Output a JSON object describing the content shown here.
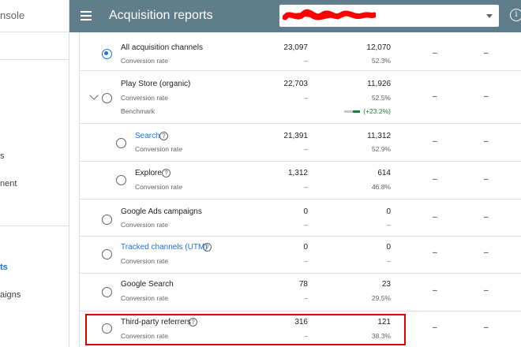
{
  "sidebar": {
    "brand": "nsole",
    "items": [
      "s",
      "nent",
      "ts",
      "aigns"
    ]
  },
  "header": {
    "title": "Acquisition reports",
    "app_selector_value": "",
    "info_glyph": "i"
  },
  "labels": {
    "conversion_rate": "Conversion rate",
    "benchmark": "Benchmark",
    "dash": "–"
  },
  "rows": [
    {
      "name": "All acquisition channels",
      "visitors": "23,097",
      "installers": "12,070",
      "rate": "52.3%",
      "conv_dash": "–",
      "selected": true
    },
    {
      "name": "Play Store (organic)",
      "visitors": "22,703",
      "installers": "11,926",
      "rate": "52.5%",
      "conv_dash": "–",
      "benchmark_change": "(+23.2%)",
      "expandable": true
    },
    {
      "name": "Search",
      "visitors": "21,391",
      "installers": "11,312",
      "rate": "52.9%",
      "conv_dash": "–",
      "link": true,
      "help": true
    },
    {
      "name": "Explore",
      "visitors": "1,312",
      "installers": "614",
      "rate": "46.8%",
      "conv_dash": "–",
      "help": true
    },
    {
      "name": "Google Ads campaigns",
      "visitors": "0",
      "installers": "0",
      "rate": "–",
      "conv_dash": "–"
    },
    {
      "name": "Tracked channels (UTM)",
      "visitors": "0",
      "installers": "0",
      "rate": "–",
      "conv_dash": "–",
      "link": true,
      "help": true
    },
    {
      "name": "Google Search",
      "visitors": "78",
      "installers": "23",
      "rate": "29.5%",
      "conv_dash": "–"
    },
    {
      "name": "Third-party referrers",
      "visitors": "316",
      "installers": "121",
      "rate": "38.3%",
      "conv_dash": "–",
      "help": true
    }
  ],
  "colors": {
    "header": "#607d8b",
    "link": "#1a73e8",
    "positive": "#188038",
    "highlight": "#e00000"
  }
}
